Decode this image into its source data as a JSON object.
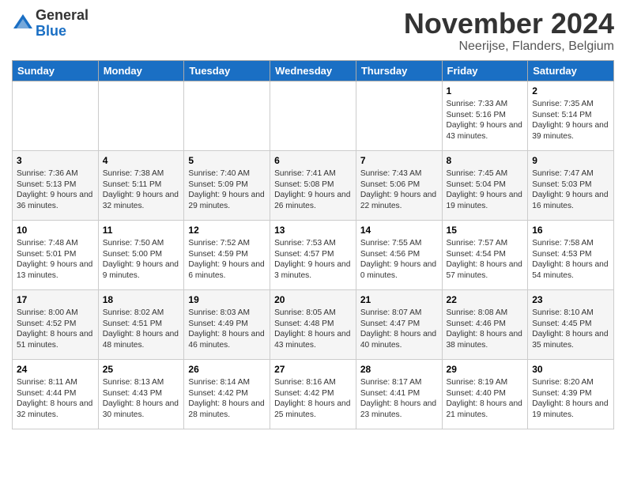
{
  "logo": {
    "general": "General",
    "blue": "Blue"
  },
  "header": {
    "month": "November 2024",
    "location": "Neerijse, Flanders, Belgium"
  },
  "days_of_week": [
    "Sunday",
    "Monday",
    "Tuesday",
    "Wednesday",
    "Thursday",
    "Friday",
    "Saturday"
  ],
  "weeks": [
    [
      {
        "day": "",
        "info": ""
      },
      {
        "day": "",
        "info": ""
      },
      {
        "day": "",
        "info": ""
      },
      {
        "day": "",
        "info": ""
      },
      {
        "day": "",
        "info": ""
      },
      {
        "day": "1",
        "info": "Sunrise: 7:33 AM\nSunset: 5:16 PM\nDaylight: 9 hours and 43 minutes."
      },
      {
        "day": "2",
        "info": "Sunrise: 7:35 AM\nSunset: 5:14 PM\nDaylight: 9 hours and 39 minutes."
      }
    ],
    [
      {
        "day": "3",
        "info": "Sunrise: 7:36 AM\nSunset: 5:13 PM\nDaylight: 9 hours and 36 minutes."
      },
      {
        "day": "4",
        "info": "Sunrise: 7:38 AM\nSunset: 5:11 PM\nDaylight: 9 hours and 32 minutes."
      },
      {
        "day": "5",
        "info": "Sunrise: 7:40 AM\nSunset: 5:09 PM\nDaylight: 9 hours and 29 minutes."
      },
      {
        "day": "6",
        "info": "Sunrise: 7:41 AM\nSunset: 5:08 PM\nDaylight: 9 hours and 26 minutes."
      },
      {
        "day": "7",
        "info": "Sunrise: 7:43 AM\nSunset: 5:06 PM\nDaylight: 9 hours and 22 minutes."
      },
      {
        "day": "8",
        "info": "Sunrise: 7:45 AM\nSunset: 5:04 PM\nDaylight: 9 hours and 19 minutes."
      },
      {
        "day": "9",
        "info": "Sunrise: 7:47 AM\nSunset: 5:03 PM\nDaylight: 9 hours and 16 minutes."
      }
    ],
    [
      {
        "day": "10",
        "info": "Sunrise: 7:48 AM\nSunset: 5:01 PM\nDaylight: 9 hours and 13 minutes."
      },
      {
        "day": "11",
        "info": "Sunrise: 7:50 AM\nSunset: 5:00 PM\nDaylight: 9 hours and 9 minutes."
      },
      {
        "day": "12",
        "info": "Sunrise: 7:52 AM\nSunset: 4:59 PM\nDaylight: 9 hours and 6 minutes."
      },
      {
        "day": "13",
        "info": "Sunrise: 7:53 AM\nSunset: 4:57 PM\nDaylight: 9 hours and 3 minutes."
      },
      {
        "day": "14",
        "info": "Sunrise: 7:55 AM\nSunset: 4:56 PM\nDaylight: 9 hours and 0 minutes."
      },
      {
        "day": "15",
        "info": "Sunrise: 7:57 AM\nSunset: 4:54 PM\nDaylight: 8 hours and 57 minutes."
      },
      {
        "day": "16",
        "info": "Sunrise: 7:58 AM\nSunset: 4:53 PM\nDaylight: 8 hours and 54 minutes."
      }
    ],
    [
      {
        "day": "17",
        "info": "Sunrise: 8:00 AM\nSunset: 4:52 PM\nDaylight: 8 hours and 51 minutes."
      },
      {
        "day": "18",
        "info": "Sunrise: 8:02 AM\nSunset: 4:51 PM\nDaylight: 8 hours and 48 minutes."
      },
      {
        "day": "19",
        "info": "Sunrise: 8:03 AM\nSunset: 4:49 PM\nDaylight: 8 hours and 46 minutes."
      },
      {
        "day": "20",
        "info": "Sunrise: 8:05 AM\nSunset: 4:48 PM\nDaylight: 8 hours and 43 minutes."
      },
      {
        "day": "21",
        "info": "Sunrise: 8:07 AM\nSunset: 4:47 PM\nDaylight: 8 hours and 40 minutes."
      },
      {
        "day": "22",
        "info": "Sunrise: 8:08 AM\nSunset: 4:46 PM\nDaylight: 8 hours and 38 minutes."
      },
      {
        "day": "23",
        "info": "Sunrise: 8:10 AM\nSunset: 4:45 PM\nDaylight: 8 hours and 35 minutes."
      }
    ],
    [
      {
        "day": "24",
        "info": "Sunrise: 8:11 AM\nSunset: 4:44 PM\nDaylight: 8 hours and 32 minutes."
      },
      {
        "day": "25",
        "info": "Sunrise: 8:13 AM\nSunset: 4:43 PM\nDaylight: 8 hours and 30 minutes."
      },
      {
        "day": "26",
        "info": "Sunrise: 8:14 AM\nSunset: 4:42 PM\nDaylight: 8 hours and 28 minutes."
      },
      {
        "day": "27",
        "info": "Sunrise: 8:16 AM\nSunset: 4:42 PM\nDaylight: 8 hours and 25 minutes."
      },
      {
        "day": "28",
        "info": "Sunrise: 8:17 AM\nSunset: 4:41 PM\nDaylight: 8 hours and 23 minutes."
      },
      {
        "day": "29",
        "info": "Sunrise: 8:19 AM\nSunset: 4:40 PM\nDaylight: 8 hours and 21 minutes."
      },
      {
        "day": "30",
        "info": "Sunrise: 8:20 AM\nSunset: 4:39 PM\nDaylight: 8 hours and 19 minutes."
      }
    ]
  ]
}
